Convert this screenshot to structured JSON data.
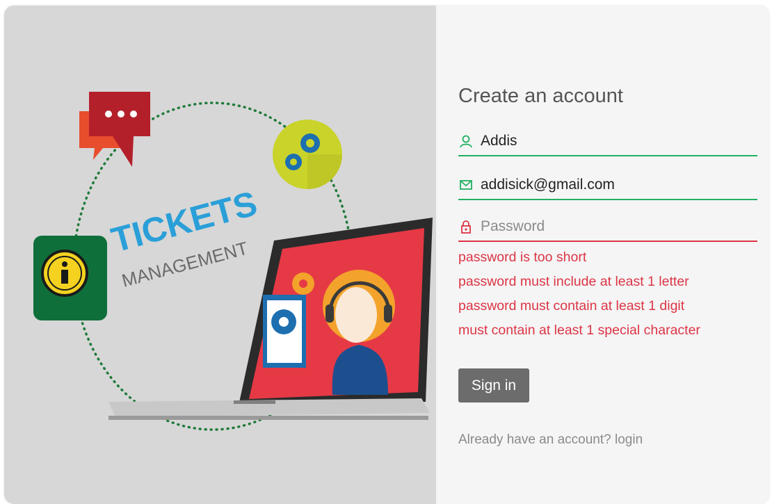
{
  "illustration": {
    "brand_title": "TICKETS",
    "brand_subtitle": "MANAGEMENT",
    "icons": [
      "chat-bubble-icon",
      "gears-icon",
      "info-icon",
      "laptop-support-agent"
    ]
  },
  "form": {
    "title": "Create an account",
    "username": {
      "value": "Addis",
      "icon": "user-icon"
    },
    "email": {
      "value": "addisick@gmail.com",
      "icon": "mail-icon"
    },
    "password": {
      "value": "",
      "placeholder": "Password",
      "icon": "lock-icon"
    },
    "errors": [
      "password is too short",
      "password must include at least 1 letter",
      "password must contain at least 1 digit",
      "must contain at least 1 special character"
    ],
    "submit_label": "Sign in",
    "login_prompt": "Already have an account?",
    "login_link": "login"
  },
  "colors": {
    "valid": "#20b060",
    "invalid": "#dc3545",
    "button": "#6c6c6c",
    "brand_blue": "#2a9fd8"
  }
}
